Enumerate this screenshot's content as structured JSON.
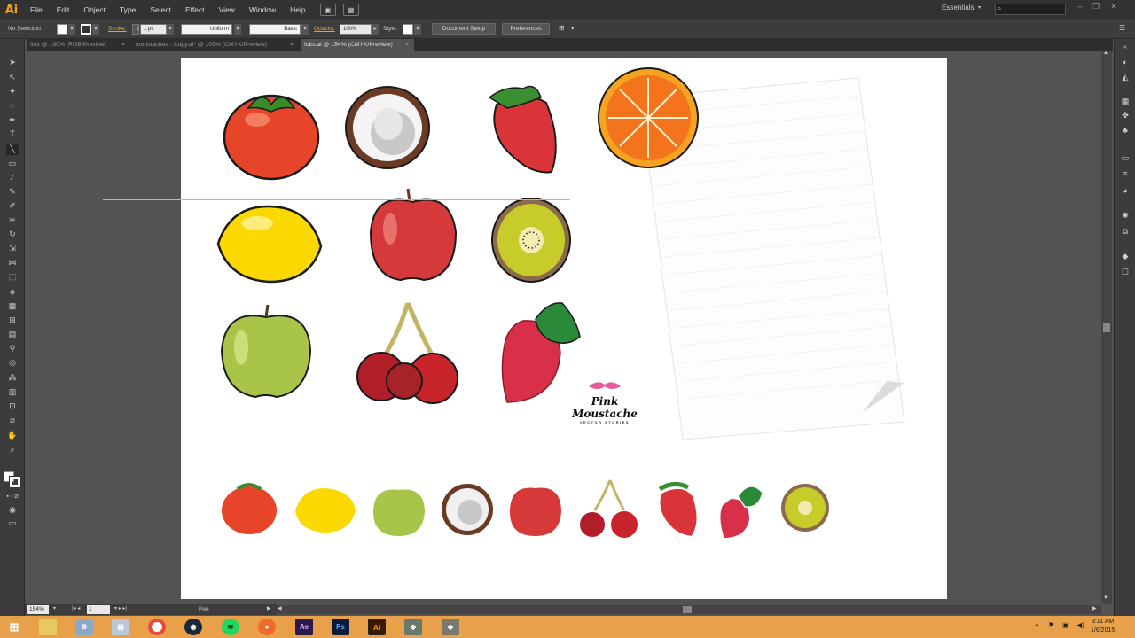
{
  "app": {
    "logo": "Ai"
  },
  "menu": [
    "File",
    "Edit",
    "Object",
    "Type",
    "Select",
    "Effect",
    "View",
    "Window",
    "Help"
  ],
  "workspace": "Essentials",
  "control_bar": {
    "selection": "No Selection",
    "stroke_label": "Stroke:",
    "stroke_value": "1 pt",
    "uniform": "Uniform",
    "basic": "Basic",
    "opacity_label": "Opacity:",
    "opacity_value": "100%",
    "style_label": "Style:",
    "document_setup": "Document Setup",
    "preferences": "Preferences"
  },
  "tabs": [
    {
      "label": "first @ 190% (RGB/Preview)",
      "active": false
    },
    {
      "label": "moustaches - Copy.ai* @ 109% (CMYK/Preview)",
      "active": false
    },
    {
      "label": "fuits.ai @ 154% (CMYK/Preview)",
      "active": true
    }
  ],
  "status": {
    "zoom": "154%",
    "page": "1",
    "tool": "Pen"
  },
  "brand": {
    "name": "Pink Moustache",
    "sub": "VECTOR STORIES"
  },
  "clock": {
    "time": "9:11 AM",
    "date": "1/6/2015"
  },
  "colors": {
    "strip": "#6b8ccb",
    "taskbar": "#e8a04a",
    "accent": "#f7a21b"
  },
  "fruits": [
    "tomato",
    "coconut",
    "strawberry",
    "orange",
    "lemon",
    "apple",
    "kiwi",
    "green-apple",
    "cherries",
    "raspberry"
  ],
  "strip_fruits": [
    "tomato",
    "lemon",
    "green-apple",
    "coconut",
    "apple",
    "cherries",
    "strawberry",
    "raspberry",
    "kiwi"
  ]
}
